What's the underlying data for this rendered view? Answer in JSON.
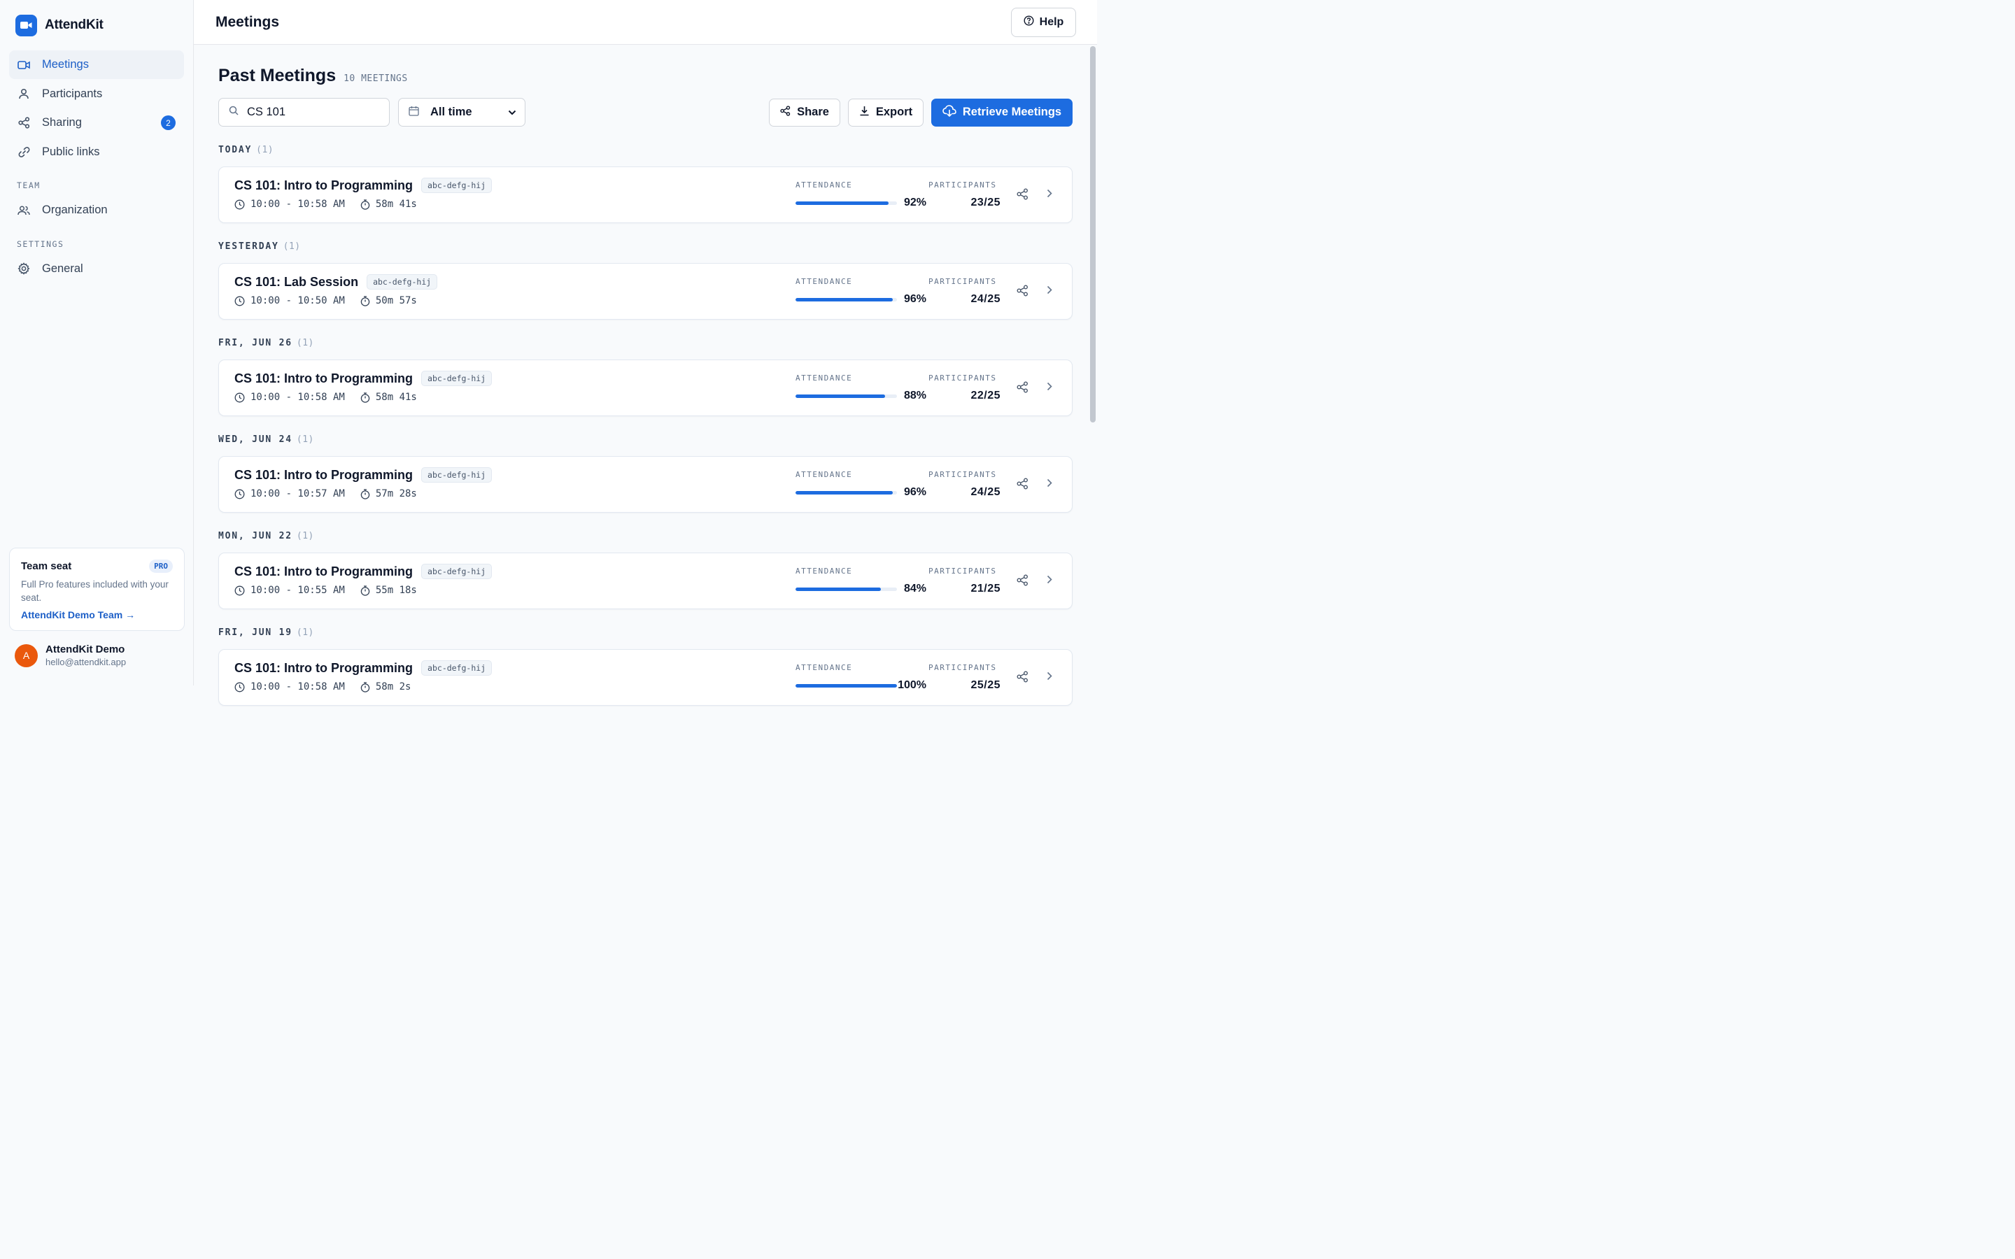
{
  "brand": {
    "name": "AttendKit",
    "logo_icon": "video-camera-icon",
    "color": "#1d6ce0"
  },
  "nav": {
    "items": [
      {
        "label": "Meetings",
        "icon": "video-icon",
        "active": true
      },
      {
        "label": "Participants",
        "icon": "user-icon"
      },
      {
        "label": "Sharing",
        "icon": "share-icon",
        "badge": "2"
      },
      {
        "label": "Public links",
        "icon": "link-icon"
      }
    ],
    "team_section": "TEAM",
    "team_items": [
      {
        "label": "Organization",
        "icon": "users-icon"
      }
    ],
    "settings_section": "SETTINGS",
    "settings_items": [
      {
        "label": "General",
        "icon": "gear-icon"
      }
    ]
  },
  "seat": {
    "title": "Team seat",
    "badge": "PRO",
    "description": "Full Pro features included with your seat.",
    "link": "AttendKit Demo Team →"
  },
  "user": {
    "initial": "A",
    "name": "AttendKit Demo",
    "email": "hello@attendkit.app",
    "avatar_color": "#ea580c"
  },
  "topbar": {
    "title": "Meetings",
    "help_label": "Help"
  },
  "main": {
    "heading": "Past Meetings",
    "count": "10 MEETINGS",
    "search": {
      "value": "CS 101"
    },
    "range": {
      "value": "All time"
    },
    "share_label": "Share",
    "export_label": "Export",
    "retrieve_label": "Retrieve Meetings",
    "attendance_label": "ATTENDANCE",
    "participants_label": "PARTICIPANTS",
    "groups": [
      {
        "label": "TODAY",
        "count": "(1)",
        "meeting": {
          "title": "CS 101: Intro to Programming",
          "code": "abc-defg-hij",
          "time": "10:00 - 10:58 AM",
          "duration": "58m 41s",
          "attendance": 92,
          "attendance_text": "92%",
          "participants": "23/25"
        }
      },
      {
        "label": "YESTERDAY",
        "count": "(1)",
        "meeting": {
          "title": "CS 101: Lab Session",
          "code": "abc-defg-hij",
          "time": "10:00 - 10:50 AM",
          "duration": "50m 57s",
          "attendance": 96,
          "attendance_text": "96%",
          "participants": "24/25"
        }
      },
      {
        "label": "FRI, JUN 26",
        "count": "(1)",
        "meeting": {
          "title": "CS 101: Intro to Programming",
          "code": "abc-defg-hij",
          "time": "10:00 - 10:58 AM",
          "duration": "58m 41s",
          "attendance": 88,
          "attendance_text": "88%",
          "participants": "22/25"
        }
      },
      {
        "label": "WED, JUN 24",
        "count": "(1)",
        "meeting": {
          "title": "CS 101: Intro to Programming",
          "code": "abc-defg-hij",
          "time": "10:00 - 10:57 AM",
          "duration": "57m 28s",
          "attendance": 96,
          "attendance_text": "96%",
          "participants": "24/25"
        }
      },
      {
        "label": "MON, JUN 22",
        "count": "(1)",
        "meeting": {
          "title": "CS 101: Intro to Programming",
          "code": "abc-defg-hij",
          "time": "10:00 - 10:55 AM",
          "duration": "55m 18s",
          "attendance": 84,
          "attendance_text": "84%",
          "participants": "21/25"
        }
      },
      {
        "label": "FRI, JUN 19",
        "count": "(1)",
        "meeting": {
          "title": "CS 101: Intro to Programming",
          "code": "abc-defg-hij",
          "time": "10:00 - 10:58 AM",
          "duration": "58m 2s",
          "attendance": 100,
          "attendance_text": "100%",
          "participants": "25/25"
        }
      }
    ]
  },
  "colors": {
    "accent": "#1d6ce0",
    "active_text": "#1d5fc7"
  }
}
